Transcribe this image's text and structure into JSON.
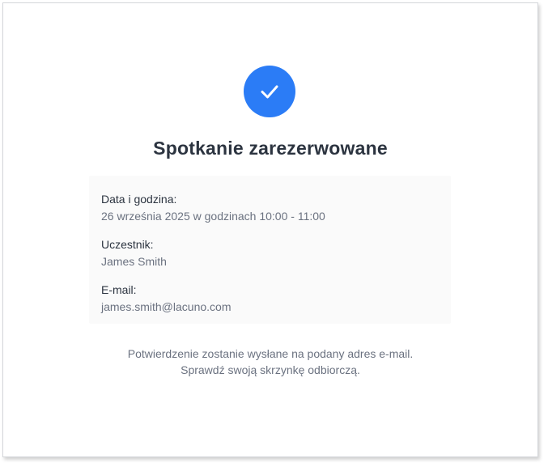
{
  "confirmation": {
    "icon": "check-icon",
    "accent_color": "#2b7cf6",
    "title": "Spotkanie zarezerwowane"
  },
  "details": {
    "datetime_label": "Data i godzina:",
    "datetime_value": "26 września 2025 w godzinach 10:00 - 11:00",
    "participant_label": "Uczestnik:",
    "participant_value": "James Smith",
    "email_label": "E-mail:",
    "email_value": "james.smith@lacuno.com"
  },
  "note": {
    "line1": "Potwierdzenie zostanie wysłane na podany adres e-mail.",
    "line2": "Sprawdź swoją skrzynkę odbiorczą."
  }
}
